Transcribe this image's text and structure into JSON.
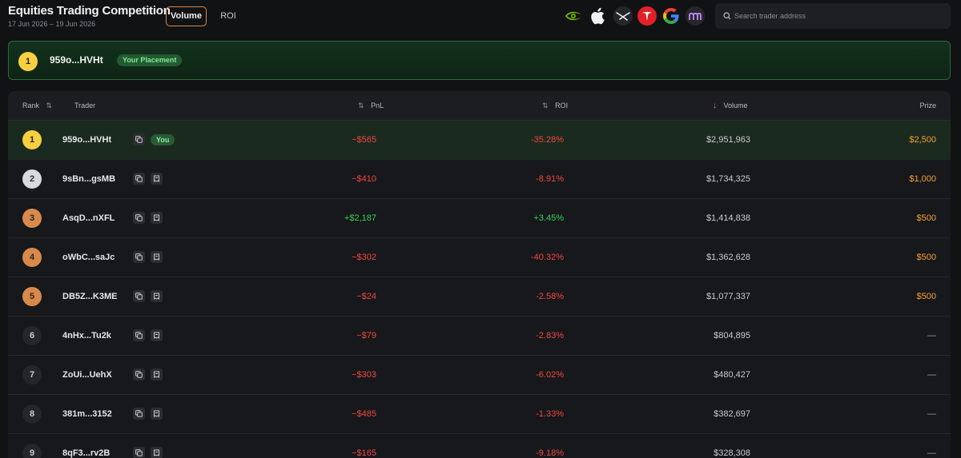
{
  "header": {
    "title": "Equities Trading Competition",
    "date_range": "17 Jun 2026 – 19 Jun 2026",
    "tabs": [
      {
        "label": "Volume",
        "active": true
      },
      {
        "label": "ROI",
        "active": false
      }
    ],
    "logos": [
      "nvidia-logo",
      "apple-logo",
      "spacex-logo",
      "tesla-logo",
      "google-logo",
      "meta-logo"
    ],
    "search": {
      "placeholder": "Search trader address",
      "value": ""
    }
  },
  "placement": {
    "rank": "1",
    "address": "959o...HVHt",
    "badge": "Your Placement"
  },
  "table": {
    "columns": {
      "rank": "Rank",
      "trader": "Trader",
      "pnl": "PnL",
      "roi": "ROI",
      "volume": "Volume",
      "prize": "Prize"
    },
    "sorted_by": "volume",
    "you_label": "You",
    "rows": [
      {
        "rank": "1",
        "trader": "959o...HVHt",
        "pnl": "−$565",
        "roi": "-35.28%",
        "volume": "$2,951,963",
        "prize": "$2,500",
        "you": true
      },
      {
        "rank": "2",
        "trader": "9sBn...gsMB",
        "pnl": "−$410",
        "roi": "-8.91%",
        "volume": "$1,734,325",
        "prize": "$1,000"
      },
      {
        "rank": "3",
        "trader": "AsqD...nXFL",
        "pnl": "+$2,187",
        "roi": "+3.45%",
        "volume": "$1,414,838",
        "prize": "$500"
      },
      {
        "rank": "4",
        "trader": "oWbC...saJc",
        "pnl": "−$302",
        "roi": "-40.32%",
        "volume": "$1,362,628",
        "prize": "$500"
      },
      {
        "rank": "5",
        "trader": "DB5Z...K3ME",
        "pnl": "−$24",
        "roi": "-2.58%",
        "volume": "$1,077,337",
        "prize": "$500"
      },
      {
        "rank": "6",
        "trader": "4nHx...Tu2k",
        "pnl": "−$79",
        "roi": "-2.83%",
        "volume": "$804,895",
        "prize": "—"
      },
      {
        "rank": "7",
        "trader": "ZoUi...UehX",
        "pnl": "−$303",
        "roi": "-6.02%",
        "volume": "$480,427",
        "prize": "—"
      },
      {
        "rank": "8",
        "trader": "381m...3152",
        "pnl": "−$485",
        "roi": "-1.33%",
        "volume": "$382,697",
        "prize": "—"
      },
      {
        "rank": "9",
        "trader": "8qF3...rv2B",
        "pnl": "−$165",
        "roi": "-9.18%",
        "volume": "$328,308",
        "prize": "—"
      }
    ]
  },
  "colors": {
    "accent": "#d98a46",
    "negative": "#f0473f",
    "positive": "#33d35e",
    "prize": "#f5a033",
    "gold": "#f7cf41",
    "silver": "#d7d9dc",
    "bronze": "#d88a4c"
  }
}
